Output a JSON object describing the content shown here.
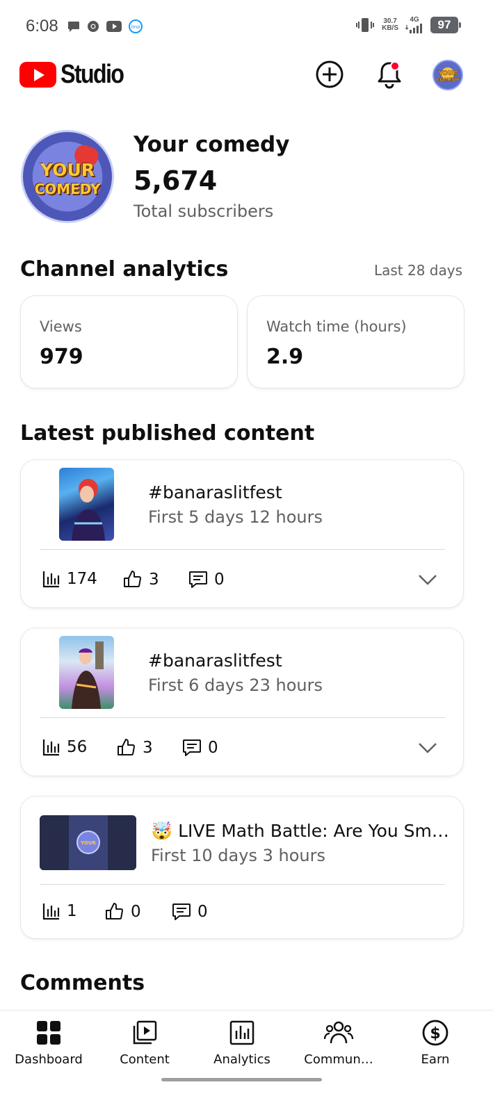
{
  "status_bar": {
    "time": "6:08",
    "net_speed_value": "30.7",
    "net_speed_unit": "KB/S",
    "network": "4G",
    "battery": "97",
    "left_icons": [
      "message-icon",
      "chrome-icon",
      "youtube-icon",
      "imo-icon"
    ],
    "right_icons": [
      "vibrate-icon",
      "signal-icon",
      "battery-icon"
    ]
  },
  "header": {
    "logo_text": "Studio",
    "brand_color": "#ff0000",
    "create_icon": "create-plus-icon",
    "notifications_icon": "bell-icon",
    "notification_dot_color": "#ff0033"
  },
  "channel": {
    "name": "Your comedy",
    "subscriber_count": "5,674",
    "subscriber_label": "Total subscribers",
    "avatar_text_1": "YOUR",
    "avatar_text_2": "COMEDY"
  },
  "analytics": {
    "title": "Channel analytics",
    "range": "Last 28 days",
    "cards": [
      {
        "label": "Views",
        "value": "979"
      },
      {
        "label": "Watch time (hours)",
        "value": "2.9"
      }
    ]
  },
  "latest": {
    "title": "Latest published content",
    "items": [
      {
        "title": "#banaraslitfest",
        "subtitle": "First 5 days 12 hours",
        "views": "174",
        "likes": "3",
        "comments": "0",
        "expandable": true
      },
      {
        "title": "#banaraslitfest",
        "subtitle": "First 6 days 23 hours",
        "views": "56",
        "likes": "3",
        "comments": "0",
        "expandable": true
      },
      {
        "title": "🤯 LIVE Math Battle: Are You Sm…",
        "subtitle": "First 10 days 3 hours",
        "views": "1",
        "likes": "0",
        "comments": "0",
        "expandable": false
      }
    ]
  },
  "comments": {
    "title": "Comments"
  },
  "bottom_nav": {
    "items": [
      {
        "label": "Dashboard",
        "icon": "dashboard-icon",
        "active": true
      },
      {
        "label": "Content",
        "icon": "content-icon",
        "active": false
      },
      {
        "label": "Analytics",
        "icon": "analytics-icon",
        "active": false
      },
      {
        "label": "Commun…",
        "icon": "community-icon",
        "active": false
      },
      {
        "label": "Earn",
        "icon": "earn-icon",
        "active": false
      }
    ]
  }
}
